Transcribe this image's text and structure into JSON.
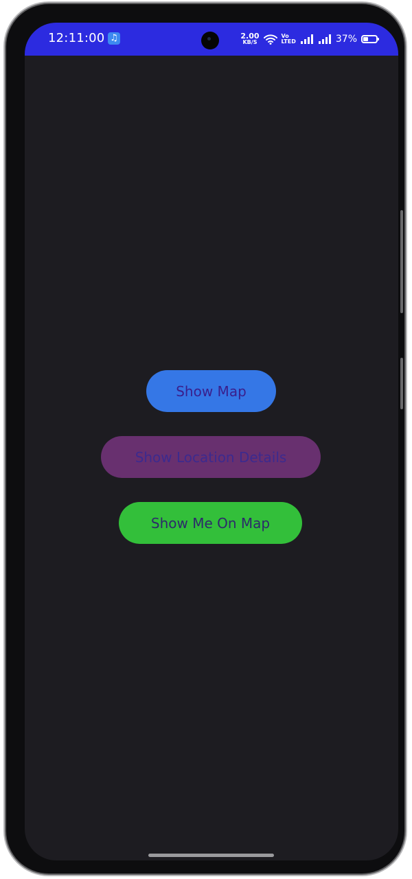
{
  "status_bar": {
    "time": "12:11:00",
    "music_icon": "music-note-icon",
    "net_speed_value": "2.00",
    "net_speed_unit": "KB/S",
    "volte_top": "Vo",
    "volte_bottom": "LTED",
    "battery_percent": "37%",
    "battery_level": 0.37,
    "color": "#2c2be0"
  },
  "main": {
    "background_color": "#1d1c21",
    "buttons": [
      {
        "label": "Show Map",
        "color": "#3577e6"
      },
      {
        "label": "Show Location Details",
        "color": "#68306f"
      },
      {
        "label": "Show Me On Map",
        "color": "#33bf3a"
      }
    ]
  }
}
